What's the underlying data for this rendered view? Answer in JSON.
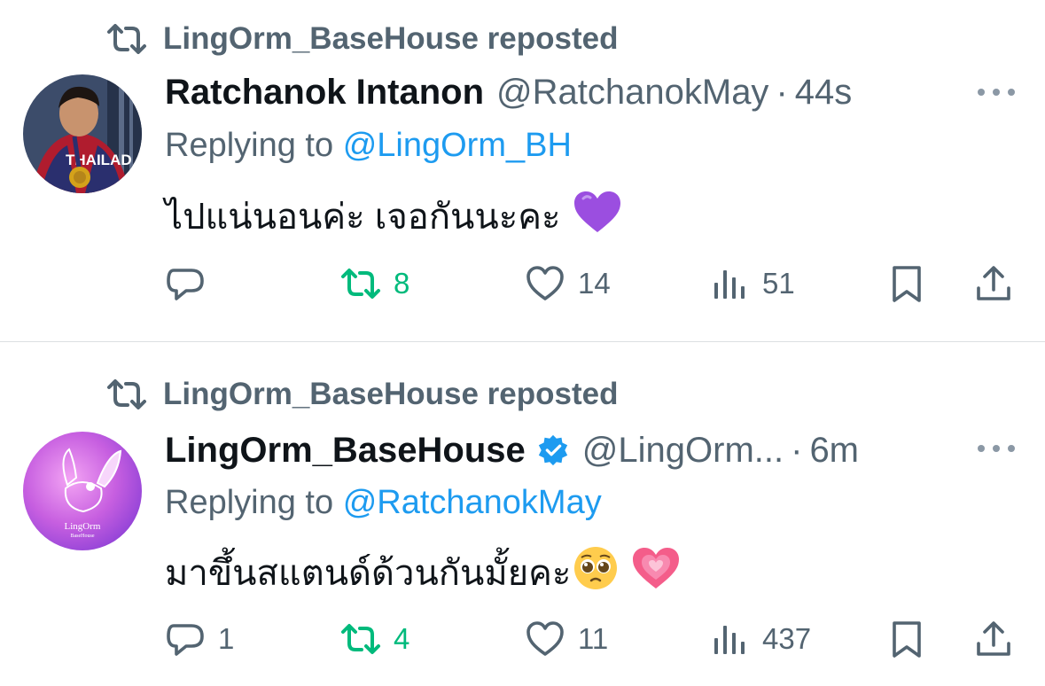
{
  "tweets": [
    {
      "reposted_by": "LingOrm_BaseHouse reposted",
      "author_name": "Ratchanok Intanon",
      "handle": "@RatchanokMay",
      "separator": "·",
      "time": "44s",
      "replying_label": "Replying to",
      "replying_to": "@LingOrm_BH",
      "text": "ไปแน่นอนค่ะ เจอกันนะคะ",
      "emojis": [
        "💜"
      ],
      "verified": false,
      "stats": {
        "replies": "",
        "reposts": "8",
        "likes": "14",
        "views": "51"
      },
      "reposted_active": true
    },
    {
      "reposted_by": "LingOrm_BaseHouse reposted",
      "author_name": "LingOrm_BaseHouse",
      "handle": "@LingOrm...",
      "separator": "·",
      "time": "6m",
      "replying_label": "Replying to",
      "replying_to": "@RatchanokMay",
      "text": "มาขึ้นสแตนด์ด้วนกันมั้ยคะ",
      "emojis": [
        "🥹",
        "💗"
      ],
      "verified": true,
      "avatar_logo_text": "LingOrm",
      "avatar_logo_subtext": "BaseHouse",
      "stats": {
        "replies": "1",
        "reposts": "4",
        "likes": "11",
        "views": "437"
      },
      "reposted_active": true
    }
  ],
  "colors": {
    "text_primary": "#0f1419",
    "text_secondary": "#536471",
    "link": "#1d9bf0",
    "repost_green": "#00ba7c",
    "verified_blue": "#1d9bf0"
  },
  "icons": [
    "repost-icon",
    "more-icon",
    "reply-icon",
    "like-icon",
    "views-icon",
    "bookmark-icon",
    "share-icon",
    "verified-icon"
  ]
}
